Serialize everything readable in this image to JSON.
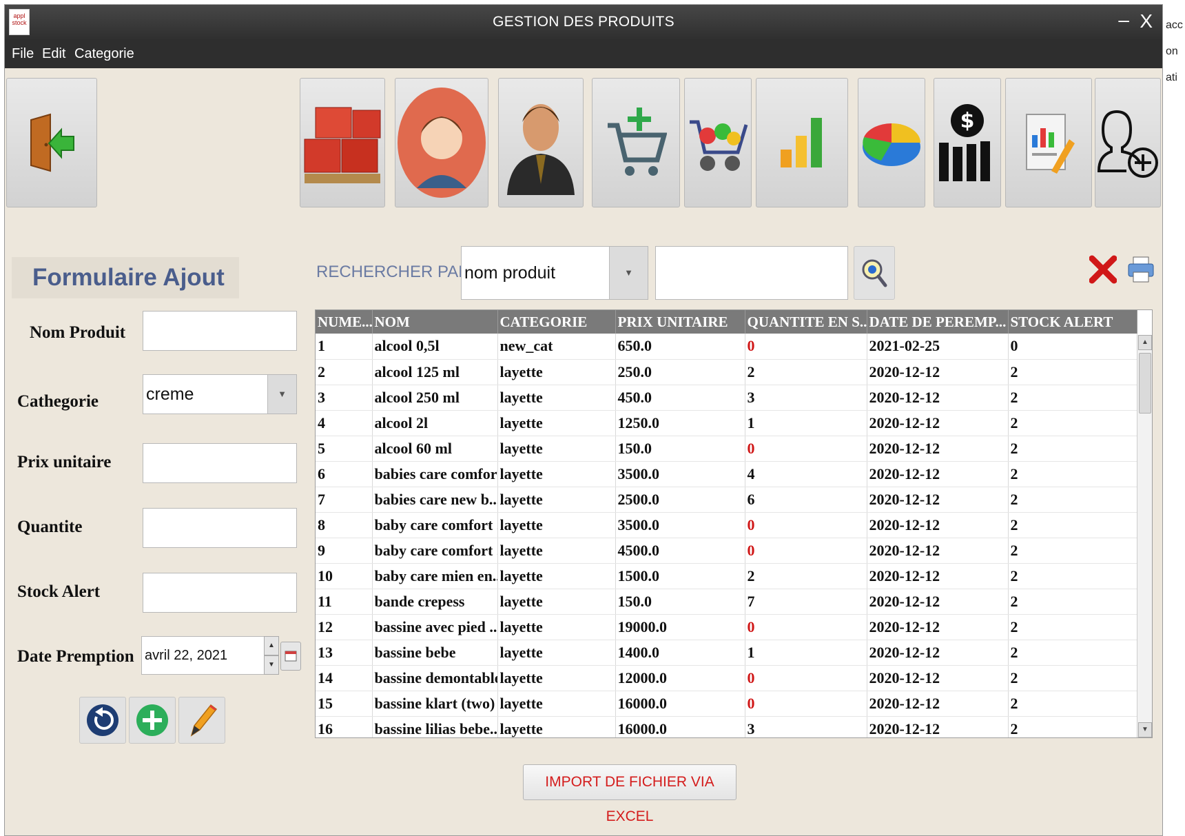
{
  "window": {
    "title": "GESTION DES PRODUITS",
    "minimize": "–",
    "close": "X",
    "app_icon_text": "appl stock"
  },
  "menu": [
    "File",
    "Edit",
    "Categorie"
  ],
  "form": {
    "title": "Formulaire Ajout",
    "labels": {
      "nom": "Nom Produit",
      "categorie": "Cathegorie",
      "prix": "Prix unitaire",
      "quantite": "Quantite",
      "stock": "Stock Alert",
      "date": "Date Premption"
    },
    "categorie_value": "creme",
    "date_value": "avril 22, 2021"
  },
  "search": {
    "label": "RECHERCHER PAR",
    "field_value": "nom produit"
  },
  "table": {
    "columns": [
      "NUME...",
      "NOM",
      "CATEGORIE",
      "PRIX UNITAIRE",
      "QUANTITE EN S...",
      "DATE DE PEREMP...",
      "STOCK ALERT"
    ],
    "rows": [
      [
        "1",
        "alcool 0,5l",
        "new_cat",
        "650.0",
        "0",
        "2021-02-25",
        "0"
      ],
      [
        "2",
        "alcool 125 ml",
        "layette",
        "250.0",
        "2",
        "2020-12-12",
        "2"
      ],
      [
        "3",
        "alcool 250 ml",
        "layette",
        "450.0",
        "3",
        "2020-12-12",
        "2"
      ],
      [
        "4",
        "alcool 2l",
        "layette",
        "1250.0",
        "1",
        "2020-12-12",
        "2"
      ],
      [
        "5",
        "alcool 60 ml",
        "layette",
        "150.0",
        "0",
        "2020-12-12",
        "2"
      ],
      [
        "6",
        "babies care comfort",
        "layette",
        "3500.0",
        "4",
        "2020-12-12",
        "2"
      ],
      [
        "7",
        "babies care new b...",
        "layette",
        "2500.0",
        "6",
        "2020-12-12",
        "2"
      ],
      [
        "8",
        "baby care comfort ...",
        "layette",
        "3500.0",
        "0",
        "2020-12-12",
        "2"
      ],
      [
        "9",
        "baby care comfort ...",
        "layette",
        "4500.0",
        "0",
        "2020-12-12",
        "2"
      ],
      [
        "10",
        "baby care mien en...",
        "layette",
        "1500.0",
        "2",
        "2020-12-12",
        "2"
      ],
      [
        "11",
        "bande crepess",
        "layette",
        "150.0",
        "7",
        "2020-12-12",
        "2"
      ],
      [
        "12",
        "bassine avec pied ...",
        "layette",
        "19000.0",
        "0",
        "2020-12-12",
        "2"
      ],
      [
        "13",
        "bassine bebe",
        "layette",
        "1400.0",
        "1",
        "2020-12-12",
        "2"
      ],
      [
        "14",
        "bassine demontable",
        "layette",
        "12000.0",
        "0",
        "2020-12-12",
        "2"
      ],
      [
        "15",
        "bassine klart (two)",
        "layette",
        "16000.0",
        "0",
        "2020-12-12",
        "2"
      ],
      [
        "16",
        "bassine lilias bebe...",
        "layette",
        "16000.0",
        "3",
        "2020-12-12",
        "2"
      ]
    ]
  },
  "import_button": "IMPORT DE FICHIER VIA EXCEL",
  "side_fragments": [
    "acc",
    "on",
    "ati"
  ],
  "colors": {
    "alert_red": "#d01818",
    "accent_blue": "#4a5d8c",
    "window_bg": "#ede7dc",
    "titlebar": "#2f2f2f"
  }
}
